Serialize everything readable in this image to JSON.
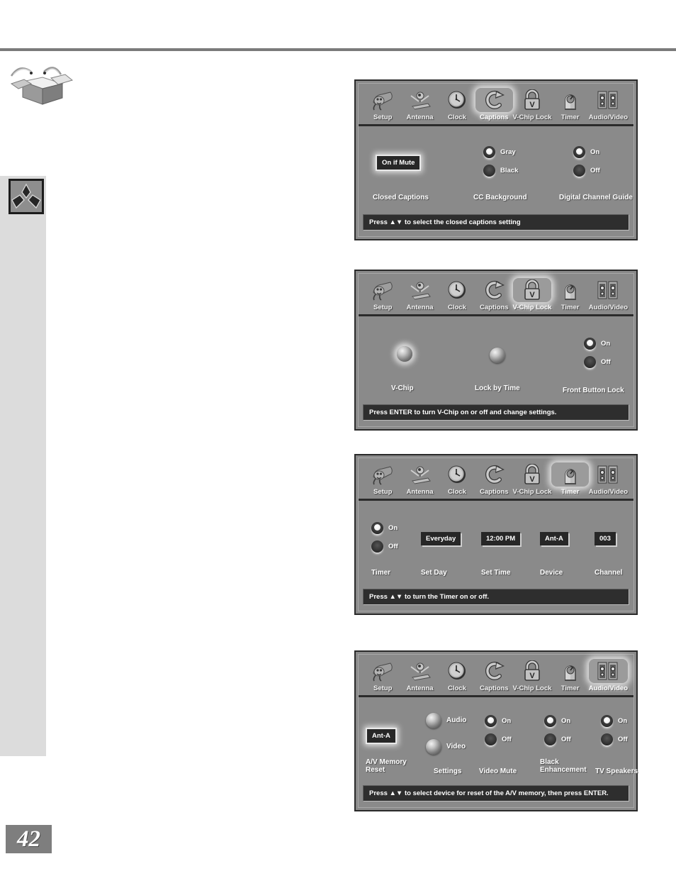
{
  "page": {
    "number": "42"
  },
  "sidebar": {
    "box_icon": "open-box-icon",
    "brand_icon": "mitsubishi-logo-icon"
  },
  "menu_icons": [
    {
      "label": "Setup",
      "icon": "power-plug-icon"
    },
    {
      "label": "Antenna",
      "icon": "satellite-dish-icon"
    },
    {
      "label": "Clock",
      "icon": "clock-icon"
    },
    {
      "label": "Captions",
      "icon": "captions-c-arrow-icon"
    },
    {
      "label": "V-Chip Lock",
      "icon": "padlock-v-icon"
    },
    {
      "label": "Timer",
      "icon": "timer-dial-icon"
    },
    {
      "label": "Audio/Video",
      "icon": "speakers-icon"
    }
  ],
  "panels": [
    {
      "id": "captions",
      "active_index": 3,
      "status": "Press ▲▼ to select the closed captions setting",
      "groups": [
        {
          "label": "Closed Captions",
          "value": "On if Mute"
        },
        {
          "label": "CC Background",
          "options": [
            "Gray",
            "Black"
          ],
          "selected": "Gray"
        },
        {
          "label": "Digital Channel Guide",
          "options": [
            "On",
            "Off"
          ],
          "selected": "On"
        }
      ]
    },
    {
      "id": "vchip_lock",
      "active_index": 4,
      "status": "Press ENTER to turn V-Chip on or off and change settings.",
      "groups": [
        {
          "label": "V-Chip",
          "control": "sphere",
          "focused": true
        },
        {
          "label": "Lock by Time",
          "control": "sphere",
          "focused": false
        },
        {
          "label": "Front Button Lock",
          "options": [
            "On",
            "Off"
          ],
          "selected": "On"
        }
      ]
    },
    {
      "id": "timer",
      "active_index": 5,
      "status": "Press ▲▼ to turn the Timer on or off.",
      "groups": [
        {
          "label": "Timer",
          "options": [
            "On",
            "Off"
          ],
          "selected": "On"
        },
        {
          "label": "Set Day",
          "value": "Everyday"
        },
        {
          "label": "Set Time",
          "value": "12:00 PM"
        },
        {
          "label": "Device",
          "value": "Ant-A"
        },
        {
          "label": "Channel",
          "value": "003"
        }
      ]
    },
    {
      "id": "audio_video",
      "active_index": 6,
      "status": "Press ▲▼ to select device for reset of the A/V memory, then press ENTER.",
      "groups": [
        {
          "label": "A/V Memory Reset",
          "value": "Ant-A",
          "focused": true
        },
        {
          "label": "Settings",
          "spheres": [
            "Audio",
            "Video"
          ]
        },
        {
          "label": "Video Mute",
          "options": [
            "On",
            "Off"
          ],
          "selected": "On"
        },
        {
          "label": "Black Enhancement",
          "options": [
            "On",
            "Off"
          ],
          "selected": "On"
        },
        {
          "label": "TV Speakers",
          "options": [
            "On",
            "Off"
          ],
          "selected": "On"
        }
      ]
    }
  ],
  "colors": {
    "osd_background": "#8a8a8a",
    "osd_border": "#2a2a2a",
    "status_background": "#2e2e2e",
    "sidebar_band": "#dcdcdc",
    "rule": "#7a7a7a",
    "page_number_background": "#7e7e7e"
  }
}
